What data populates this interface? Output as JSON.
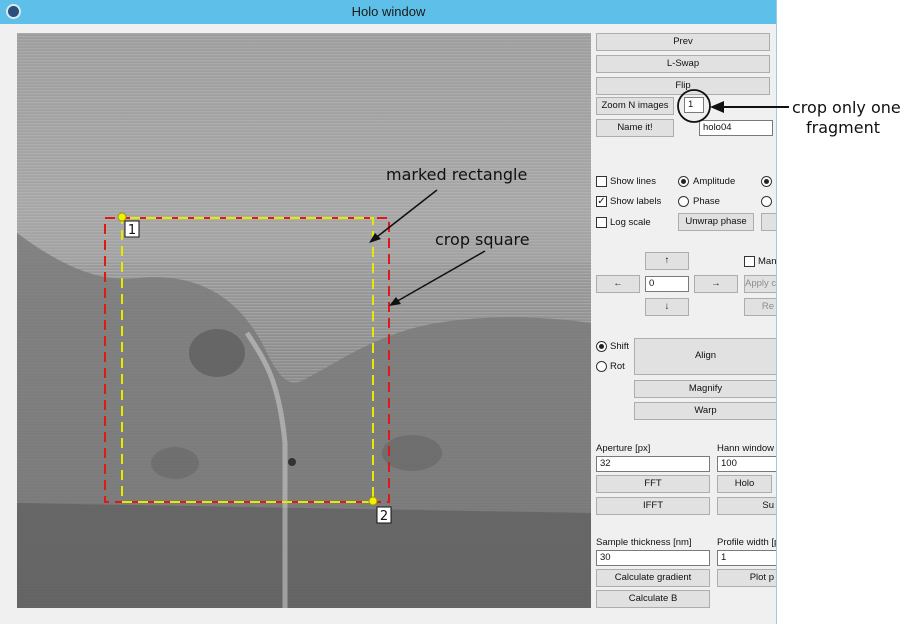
{
  "window": {
    "title": "Holo window"
  },
  "image": {
    "marker_1": "1",
    "marker_2": "2",
    "label_marked_rectangle": "marked rectangle",
    "label_crop_square": "crop square",
    "colors": {
      "marked_rectangle": "#e8e800",
      "crop_square": "#e01818"
    }
  },
  "controls": {
    "prev": "Prev",
    "lswap": "L-Swap",
    "flip": "Flip",
    "zoom_n_images": "Zoom N images",
    "zoom_n_value": "1",
    "name_it": "Name it!",
    "name_value": "holo04",
    "show_lines": "Show lines",
    "show_labels": "Show labels",
    "log_scale": "Log scale",
    "amplitude": "Amplitude",
    "phase": "Phase",
    "unwrap_phase": "Unwrap phase",
    "move_value": "0",
    "manual_partial": "Manu",
    "apply_partial": "Apply c",
    "reset_partial": "Re",
    "shift": "Shift",
    "rot": "Rot",
    "align": "Align",
    "magnify": "Magnify",
    "warp": "Warp",
    "aperture_label": "Aperture [px]",
    "aperture_value": "32",
    "hann_label": "Hann window [p",
    "hann_value": "100",
    "fft": "FFT",
    "holo": "Holo",
    "ifft": "IFFT",
    "su_partial": "Su",
    "thickness_label": "Sample thickness [nm]",
    "thickness_value": "30",
    "profile_label": "Profile width [px",
    "profile_value": "1",
    "calc_gradient": "Calculate gradient",
    "plot_partial": "Plot p",
    "calc_b": "Calculate B"
  },
  "annotation": {
    "crop_note_line1": "crop only one",
    "crop_note_line2": "fragment"
  }
}
